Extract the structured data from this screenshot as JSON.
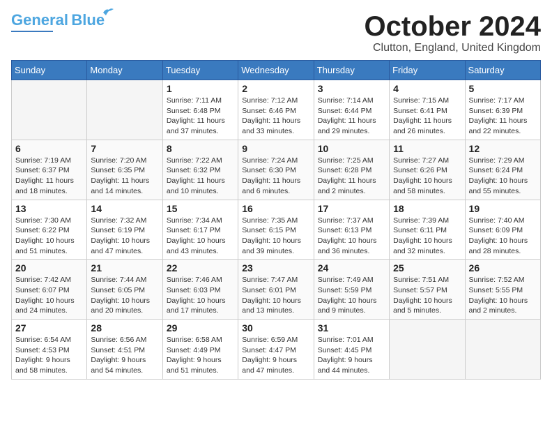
{
  "header": {
    "logo_general": "General",
    "logo_blue": "Blue",
    "month": "October 2024",
    "location": "Clutton, England, United Kingdom"
  },
  "weekdays": [
    "Sunday",
    "Monday",
    "Tuesday",
    "Wednesday",
    "Thursday",
    "Friday",
    "Saturday"
  ],
  "weeks": [
    [
      {
        "day": "",
        "info": ""
      },
      {
        "day": "",
        "info": ""
      },
      {
        "day": "1",
        "info": "Sunrise: 7:11 AM\nSunset: 6:48 PM\nDaylight: 11 hours\nand 37 minutes."
      },
      {
        "day": "2",
        "info": "Sunrise: 7:12 AM\nSunset: 6:46 PM\nDaylight: 11 hours\nand 33 minutes."
      },
      {
        "day": "3",
        "info": "Sunrise: 7:14 AM\nSunset: 6:44 PM\nDaylight: 11 hours\nand 29 minutes."
      },
      {
        "day": "4",
        "info": "Sunrise: 7:15 AM\nSunset: 6:41 PM\nDaylight: 11 hours\nand 26 minutes."
      },
      {
        "day": "5",
        "info": "Sunrise: 7:17 AM\nSunset: 6:39 PM\nDaylight: 11 hours\nand 22 minutes."
      }
    ],
    [
      {
        "day": "6",
        "info": "Sunrise: 7:19 AM\nSunset: 6:37 PM\nDaylight: 11 hours\nand 18 minutes."
      },
      {
        "day": "7",
        "info": "Sunrise: 7:20 AM\nSunset: 6:35 PM\nDaylight: 11 hours\nand 14 minutes."
      },
      {
        "day": "8",
        "info": "Sunrise: 7:22 AM\nSunset: 6:32 PM\nDaylight: 11 hours\nand 10 minutes."
      },
      {
        "day": "9",
        "info": "Sunrise: 7:24 AM\nSunset: 6:30 PM\nDaylight: 11 hours\nand 6 minutes."
      },
      {
        "day": "10",
        "info": "Sunrise: 7:25 AM\nSunset: 6:28 PM\nDaylight: 11 hours\nand 2 minutes."
      },
      {
        "day": "11",
        "info": "Sunrise: 7:27 AM\nSunset: 6:26 PM\nDaylight: 10 hours\nand 58 minutes."
      },
      {
        "day": "12",
        "info": "Sunrise: 7:29 AM\nSunset: 6:24 PM\nDaylight: 10 hours\nand 55 minutes."
      }
    ],
    [
      {
        "day": "13",
        "info": "Sunrise: 7:30 AM\nSunset: 6:22 PM\nDaylight: 10 hours\nand 51 minutes."
      },
      {
        "day": "14",
        "info": "Sunrise: 7:32 AM\nSunset: 6:19 PM\nDaylight: 10 hours\nand 47 minutes."
      },
      {
        "day": "15",
        "info": "Sunrise: 7:34 AM\nSunset: 6:17 PM\nDaylight: 10 hours\nand 43 minutes."
      },
      {
        "day": "16",
        "info": "Sunrise: 7:35 AM\nSunset: 6:15 PM\nDaylight: 10 hours\nand 39 minutes."
      },
      {
        "day": "17",
        "info": "Sunrise: 7:37 AM\nSunset: 6:13 PM\nDaylight: 10 hours\nand 36 minutes."
      },
      {
        "day": "18",
        "info": "Sunrise: 7:39 AM\nSunset: 6:11 PM\nDaylight: 10 hours\nand 32 minutes."
      },
      {
        "day": "19",
        "info": "Sunrise: 7:40 AM\nSunset: 6:09 PM\nDaylight: 10 hours\nand 28 minutes."
      }
    ],
    [
      {
        "day": "20",
        "info": "Sunrise: 7:42 AM\nSunset: 6:07 PM\nDaylight: 10 hours\nand 24 minutes."
      },
      {
        "day": "21",
        "info": "Sunrise: 7:44 AM\nSunset: 6:05 PM\nDaylight: 10 hours\nand 20 minutes."
      },
      {
        "day": "22",
        "info": "Sunrise: 7:46 AM\nSunset: 6:03 PM\nDaylight: 10 hours\nand 17 minutes."
      },
      {
        "day": "23",
        "info": "Sunrise: 7:47 AM\nSunset: 6:01 PM\nDaylight: 10 hours\nand 13 minutes."
      },
      {
        "day": "24",
        "info": "Sunrise: 7:49 AM\nSunset: 5:59 PM\nDaylight: 10 hours\nand 9 minutes."
      },
      {
        "day": "25",
        "info": "Sunrise: 7:51 AM\nSunset: 5:57 PM\nDaylight: 10 hours\nand 5 minutes."
      },
      {
        "day": "26",
        "info": "Sunrise: 7:52 AM\nSunset: 5:55 PM\nDaylight: 10 hours\nand 2 minutes."
      }
    ],
    [
      {
        "day": "27",
        "info": "Sunrise: 6:54 AM\nSunset: 4:53 PM\nDaylight: 9 hours\nand 58 minutes."
      },
      {
        "day": "28",
        "info": "Sunrise: 6:56 AM\nSunset: 4:51 PM\nDaylight: 9 hours\nand 54 minutes."
      },
      {
        "day": "29",
        "info": "Sunrise: 6:58 AM\nSunset: 4:49 PM\nDaylight: 9 hours\nand 51 minutes."
      },
      {
        "day": "30",
        "info": "Sunrise: 6:59 AM\nSunset: 4:47 PM\nDaylight: 9 hours\nand 47 minutes."
      },
      {
        "day": "31",
        "info": "Sunrise: 7:01 AM\nSunset: 4:45 PM\nDaylight: 9 hours\nand 44 minutes."
      },
      {
        "day": "",
        "info": ""
      },
      {
        "day": "",
        "info": ""
      }
    ]
  ]
}
